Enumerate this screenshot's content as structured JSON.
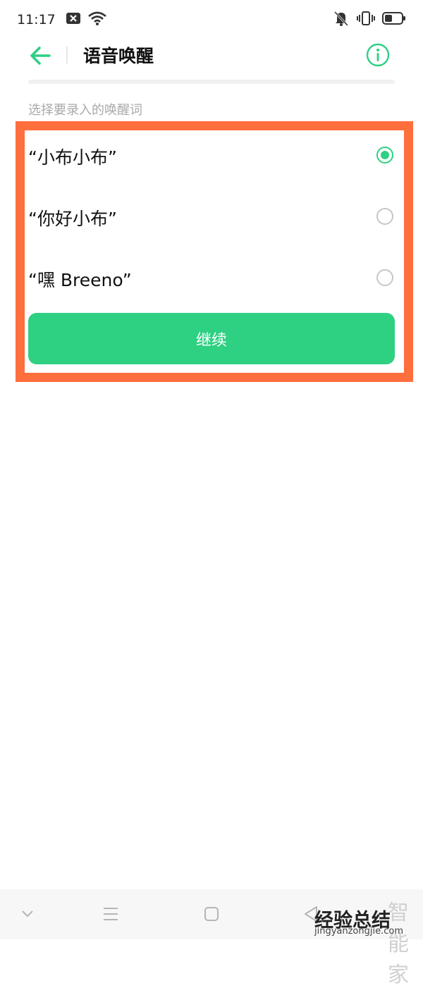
{
  "status_bar": {
    "time": "11:17",
    "icons_left": [
      "notification-close-icon",
      "wifi-icon"
    ],
    "icons_right": [
      "mute-icon",
      "vibrate-icon",
      "battery-icon"
    ]
  },
  "header": {
    "title": "语音唤醒",
    "back_icon": "back-arrow-icon",
    "info_icon": "info-icon"
  },
  "section_label": "选择要录入的唤醒词",
  "options": [
    {
      "label": "“小布小布”",
      "selected": true
    },
    {
      "label": "“你好小布”",
      "selected": false
    },
    {
      "label": "“嘿 Breeno”",
      "selected": false
    }
  ],
  "continue_label": "继续",
  "nav_bar": [
    "chevron-down-icon",
    "menu-icon",
    "home-icon",
    "back-icon"
  ],
  "watermark": {
    "top": "智能家",
    "main": "经验总结",
    "sub": "jingyanzongjie.com"
  },
  "colors": {
    "accent": "#2ed082",
    "highlight": "#ff6e3d"
  }
}
